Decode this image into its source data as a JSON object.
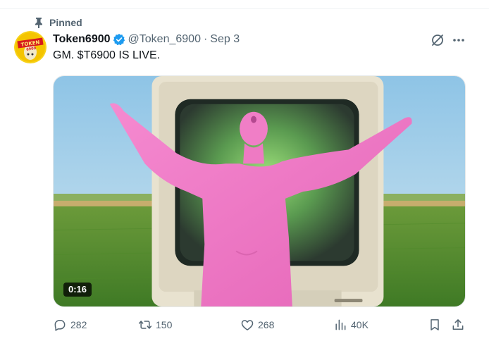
{
  "pinned_label": "Pinned",
  "author": {
    "display_name": "Token6900",
    "handle": "@Token_6900",
    "avatar_text": "TOKEN 6900",
    "verified": true
  },
  "separator": "·",
  "timestamp": "Sep 3",
  "text": "GM. $T6900 IS LIVE.",
  "media": {
    "type": "video",
    "duration": "0:16"
  },
  "actions": {
    "replies": "282",
    "reposts": "150",
    "likes": "268",
    "views": "40K"
  },
  "colors": {
    "muted": "#536471",
    "verified_blue": "#1d9bf0",
    "text": "#0f1419"
  }
}
